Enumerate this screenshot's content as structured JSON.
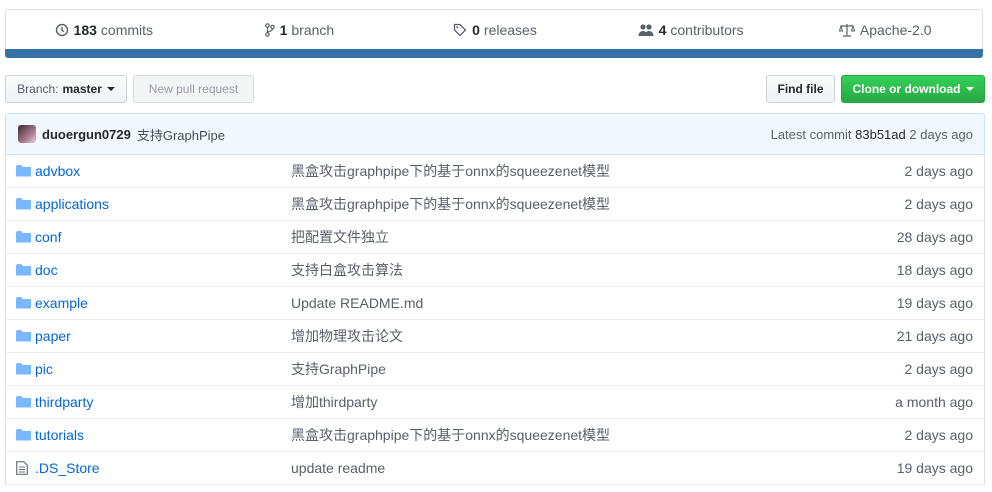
{
  "summary": {
    "commits": {
      "count": "183",
      "label": "commits"
    },
    "branches": {
      "count": "1",
      "label": "branch"
    },
    "releases": {
      "count": "0",
      "label": "releases"
    },
    "contributors": {
      "count": "4",
      "label": "contributors"
    },
    "license": {
      "label": "Apache-2.0"
    }
  },
  "toolbar": {
    "branch_prefix": "Branch:",
    "branch_name": "master",
    "new_pr": "New pull request",
    "find_file": "Find file",
    "clone": "Clone or download"
  },
  "latest_commit": {
    "author": "duoergun0729",
    "message": "支持GraphPipe",
    "prefix": "Latest commit",
    "sha": "83b51ad",
    "age": "2 days ago"
  },
  "files": [
    {
      "name": "advbox",
      "type": "dir",
      "message": "黑盒攻击graphpipe下的基于onnx的squeezenet模型",
      "age": "2 days ago"
    },
    {
      "name": "applications",
      "type": "dir",
      "message": "黑盒攻击graphpipe下的基于onnx的squeezenet模型",
      "age": "2 days ago"
    },
    {
      "name": "conf",
      "type": "dir",
      "message": "把配置文件独立",
      "age": "28 days ago"
    },
    {
      "name": "doc",
      "type": "dir",
      "message": "支持白盒攻击算法",
      "age": "18 days ago"
    },
    {
      "name": "example",
      "type": "dir",
      "message": "Update README.md",
      "age": "19 days ago"
    },
    {
      "name": "paper",
      "type": "dir",
      "message": "增加物理攻击论文",
      "age": "21 days ago"
    },
    {
      "name": "pic",
      "type": "dir",
      "message": "支持GraphPipe",
      "age": "2 days ago"
    },
    {
      "name": "thirdparty",
      "type": "dir",
      "message": "增加thirdparty",
      "age": "a month ago"
    },
    {
      "name": "tutorials",
      "type": "dir",
      "message": "黑盒攻击graphpipe下的基于onnx的squeezenet模型",
      "age": "2 days ago"
    },
    {
      "name": ".DS_Store",
      "type": "file",
      "message": "update readme",
      "age": "19 days ago"
    }
  ],
  "colors": {
    "language_bar": "#3572a5",
    "link": "#0366d6",
    "clone_button": "#28a745"
  }
}
